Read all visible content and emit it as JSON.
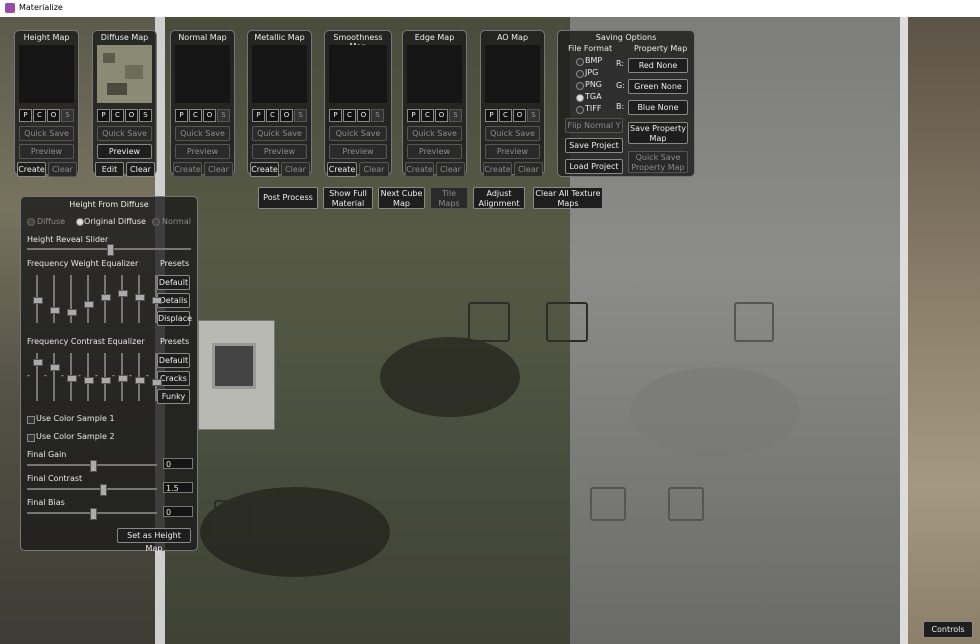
{
  "window": {
    "title": "Materialize"
  },
  "maps": [
    {
      "title": "Height Map",
      "pcos": [
        "P",
        "C",
        "O",
        "S"
      ],
      "quick_save": "Quick Save",
      "preview": "Preview",
      "create": "Create",
      "clear": "Clear"
    },
    {
      "title": "Diffuse Map",
      "pcos": [
        "P",
        "C",
        "O",
        "S"
      ],
      "quick_save": "Quick Save",
      "preview": "Preview",
      "create": "Edit",
      "clear": "Clear"
    },
    {
      "title": "Normal Map",
      "pcos": [
        "P",
        "C",
        "O",
        "S"
      ],
      "quick_save": "Quick Save",
      "preview": "Preview",
      "create": "Create",
      "clear": "Clear"
    },
    {
      "title": "Metallic Map",
      "pcos": [
        "P",
        "C",
        "O",
        "S"
      ],
      "quick_save": "Quick Save",
      "preview": "Preview",
      "create": "Create",
      "clear": "Clear"
    },
    {
      "title": "Smoothness Map",
      "pcos": [
        "P",
        "C",
        "O",
        "S"
      ],
      "quick_save": "Quick Save",
      "preview": "Preview",
      "create": "Create",
      "clear": "Clear"
    },
    {
      "title": "Edge Map",
      "pcos": [
        "P",
        "C",
        "O",
        "S"
      ],
      "quick_save": "Quick Save",
      "preview": "Preview",
      "create": "Create",
      "clear": "Clear"
    },
    {
      "title": "AO Map",
      "pcos": [
        "P",
        "C",
        "O",
        "S"
      ],
      "quick_save": "Quick Save",
      "preview": "Preview",
      "create": "Create",
      "clear": "Clear"
    }
  ],
  "saving": {
    "title": "Saving Options",
    "file_format_label": "File Format",
    "property_map_label": "Property Map",
    "formats": [
      "BMP",
      "JPG",
      "PNG",
      "TGA",
      "TIFF"
    ],
    "selected_format": "TGA",
    "channels": [
      {
        "letter": "R:",
        "value": "Red None"
      },
      {
        "letter": "G:",
        "value": "Green None"
      },
      {
        "letter": "B:",
        "value": "Blue None"
      }
    ],
    "flip_normal": "Flip Normal Y",
    "save_property_map": "Save Property Map",
    "save_project": "Save Project",
    "quick_save_property_map": "Quick Save Property Map",
    "load_project": "Load Project"
  },
  "toolbar": [
    {
      "label": "Post Process"
    },
    {
      "label": "Show Full Material"
    },
    {
      "label": "Next Cube Map"
    },
    {
      "label": "Tile Maps"
    },
    {
      "label": "Adjust Alignment"
    },
    {
      "label": "Clear All Texture Maps"
    }
  ],
  "height_panel": {
    "title": "Height From Diffuse",
    "sources": [
      "Diffuse",
      "Original Diffuse",
      "Normal"
    ],
    "selected_source": "Original Diffuse",
    "reveal_slider": "Height Reveal Slider",
    "reveal_value": 0.5,
    "freq_weight": {
      "label": "Frequency Weight Equalizer",
      "presets": "Presets",
      "buttons": [
        "Default",
        "Details",
        "Displace"
      ],
      "levels": [
        0.5,
        0.25,
        0.2,
        0.4,
        0.55,
        0.65,
        0.55,
        0.5
      ]
    },
    "freq_contrast": {
      "label": "Frequency Contrast Equalizer",
      "presets": "Presets",
      "buttons": [
        "Default",
        "Cracks",
        "Funky"
      ],
      "levels": [
        0.85,
        0.75,
        0.5,
        0.45,
        0.45,
        0.5,
        0.45,
        0.4
      ]
    },
    "color_sample_1": "Use Color Sample 1",
    "color_sample_2": "Use Color Sample 2",
    "final_gain": {
      "label": "Final Gain",
      "value": "0",
      "level": 0.5
    },
    "final_contrast": {
      "label": "Final Contrast",
      "value": "1.5",
      "level": 0.58
    },
    "final_bias": {
      "label": "Final Bias",
      "value": "0",
      "level": 0.5
    },
    "set_height": "Set as Height Map"
  },
  "controls": "Controls",
  "colors": {
    "panel": "#1c1c1c",
    "accent": "#eeeeee"
  }
}
